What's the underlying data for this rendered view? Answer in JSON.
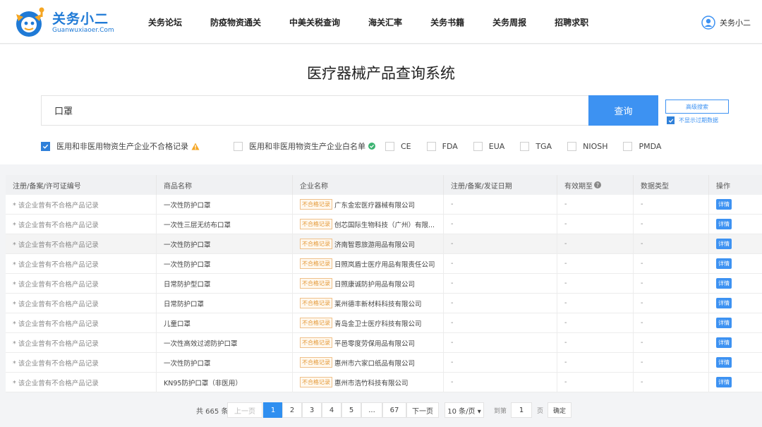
{
  "brand": {
    "name": "关务小二",
    "domain": "Guanwuxiaoer.Com",
    "primary_color": "#1f7ad6"
  },
  "nav": [
    {
      "label": "关务论坛"
    },
    {
      "label": "防疫物资通关"
    },
    {
      "label": "中美关税查询"
    },
    {
      "label": "海关汇率"
    },
    {
      "label": "关务书籍"
    },
    {
      "label": "关务周报"
    },
    {
      "label": "招聘求职"
    }
  ],
  "user": {
    "name": "关务小二",
    "icon": "user-avatar-icon"
  },
  "page": {
    "title": "医疗器械产品查询系统"
  },
  "search": {
    "value": "口罩",
    "button": "查询",
    "advanced": "高级搜索",
    "show_expired_label": "不显示过期数据",
    "show_expired_checked": true,
    "accent": "#3d92f2"
  },
  "filters": [
    {
      "label": "医用和非医用物资生产企业不合格记录",
      "checked": true,
      "icon": "warning-icon"
    },
    {
      "label": "医用和非医用物资生产企业白名单",
      "checked": false,
      "icon": "check-circle-icon"
    },
    {
      "label": "CE",
      "checked": false
    },
    {
      "label": "FDA",
      "checked": false
    },
    {
      "label": "EUA",
      "checked": false
    },
    {
      "label": "TGA",
      "checked": false
    },
    {
      "label": "NIOSH",
      "checked": false
    },
    {
      "label": "PMDA",
      "checked": false
    }
  ],
  "table": {
    "columns": [
      "注册/备案/许可证编号",
      "商品名称",
      "企业名称",
      "注册/备案/发证日期",
      "有效期至",
      "数据类型",
      "操作"
    ],
    "badge": "不合格记录",
    "badge_color": "#e49a3a",
    "action": "详情",
    "rows": [
      {
        "id": "* 该企业曾有不合格产品记录",
        "product": "一次性防护口罩",
        "company": "广东金宏医疗器械有限公司",
        "date": "-",
        "expiry": "-",
        "type": "-"
      },
      {
        "id": "* 该企业曾有不合格产品记录",
        "product": "一次性三层无纺布口罩",
        "company": "创芯国际生物科技（广州）有限...",
        "date": "-",
        "expiry": "-",
        "type": "-"
      },
      {
        "id": "* 该企业曾有不合格产品记录",
        "product": "一次性防护口罩",
        "company": "济南智恩旅游用品有限公司",
        "date": "-",
        "expiry": "-",
        "type": "-"
      },
      {
        "id": "* 该企业曾有不合格产品记录",
        "product": "一次性防护口罩",
        "company": "日照岚盾士医疗用品有限责任公司",
        "date": "-",
        "expiry": "-",
        "type": "-"
      },
      {
        "id": "* 该企业曾有不合格产品记录",
        "product": "日常防护型口罩",
        "company": "日照康诚防护用品有限公司",
        "date": "-",
        "expiry": "-",
        "type": "-"
      },
      {
        "id": "* 该企业曾有不合格产品记录",
        "product": "日常防护口罩",
        "company": "莱州德丰新材料科技有限公司",
        "date": "-",
        "expiry": "-",
        "type": "-"
      },
      {
        "id": "* 该企业曾有不合格产品记录",
        "product": "儿童口罩",
        "company": "青岛金卫士医疗科技有限公司",
        "date": "-",
        "expiry": "-",
        "type": "-"
      },
      {
        "id": "* 该企业曾有不合格产品记录",
        "product": "一次性高效过滤防护口罩",
        "company": "平邑零度劳保用品有限公司",
        "date": "-",
        "expiry": "-",
        "type": "-"
      },
      {
        "id": "* 该企业曾有不合格产品记录",
        "product": "一次性防护口罩",
        "company": "惠州市六家口纸品有限公司",
        "date": "-",
        "expiry": "-",
        "type": "-"
      },
      {
        "id": "* 该企业曾有不合格产品记录",
        "product": "KN95防护口罩（非医用）",
        "company": "惠州市浩竹科技有限公司",
        "date": "-",
        "expiry": "-",
        "type": "-"
      }
    ]
  },
  "pagination": {
    "total": "共 665 条",
    "prev": "上一页",
    "pages": [
      "1",
      "2",
      "3",
      "4",
      "5",
      "...",
      "67"
    ],
    "current": "1",
    "next": "下一页",
    "page_size": "10 条/页 ▾",
    "goto_label": "到第",
    "goto_value": "1",
    "page_unit": "页",
    "confirm": "确定"
  }
}
